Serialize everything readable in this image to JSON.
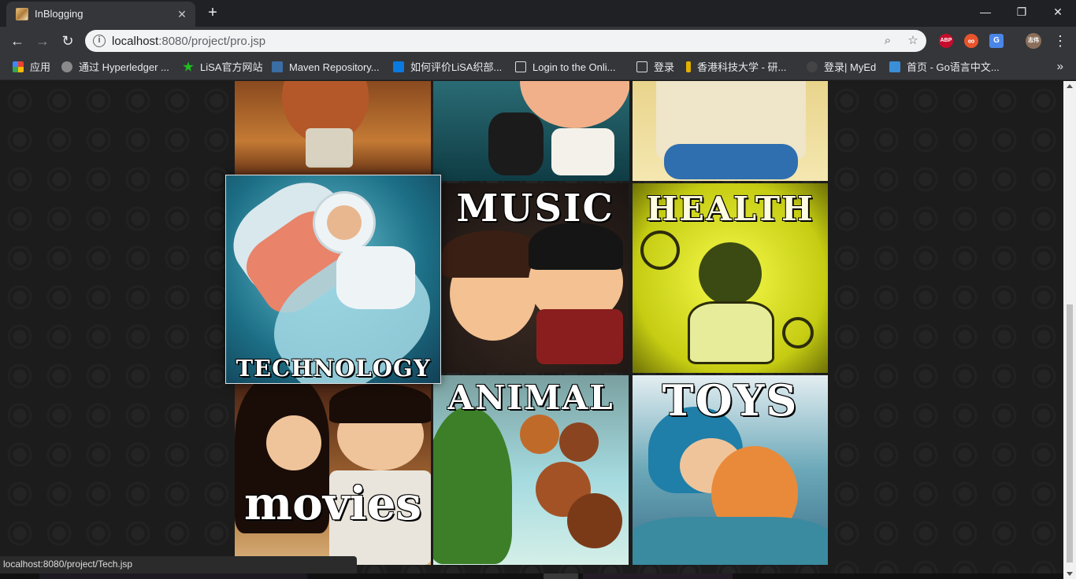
{
  "window": {
    "tab_title": "InBlogging",
    "tab_close": "✕",
    "new_tab": "+",
    "minimize": "—",
    "restore": "❐",
    "close": "✕"
  },
  "toolbar": {
    "back": "←",
    "forward": "→",
    "reload": "↻",
    "url_host": "localhost",
    "url_path": ":8080/project/pro.jsp",
    "zoom_icon": "⌕",
    "star_icon": "☆",
    "extensions": [
      {
        "name": "abp-icon",
        "label": "ABP",
        "color": "#c70d2c"
      },
      {
        "name": "infinity-icon",
        "label": "∞",
        "color": "#e8542c"
      },
      {
        "name": "translate-icon",
        "label": "G",
        "color": "#4a86e8"
      }
    ],
    "avatar_label": "志伟",
    "menu": "⋮"
  },
  "bookmarks": {
    "items": [
      {
        "label": "应用",
        "color": "#e94235"
      },
      {
        "label": "通过 Hyperledger ...",
        "color": "#cfcfcf"
      },
      {
        "label": "LiSA官方网站",
        "color": "#1fbf1f"
      },
      {
        "label": "Maven Repository...",
        "color": "#3a6ea5"
      },
      {
        "label": "如何评价LiSA织部...",
        "color": "#0a7ae0"
      },
      {
        "label": "Login to the Onli...",
        "color": "#dcdcdc"
      },
      {
        "label": "登录",
        "color": "#dcdcdc"
      },
      {
        "label": "香港科技大学 - 研...",
        "color": "#e2b100"
      },
      {
        "label": "登录| MyEd",
        "color": "#444444"
      },
      {
        "label": "首页 - Go语言中文...",
        "color": "#3b8fd6"
      }
    ],
    "more": "»"
  },
  "gallery": {
    "tiles": [
      {
        "key": "top-left",
        "label": ""
      },
      {
        "key": "top-middle",
        "label": ""
      },
      {
        "key": "top-right",
        "label": ""
      },
      {
        "key": "technology",
        "label": "TECHNOLOGY"
      },
      {
        "key": "music",
        "label": "MUSIC"
      },
      {
        "key": "health",
        "label": "HEALTH"
      },
      {
        "key": "movies",
        "label": "movies"
      },
      {
        "key": "animal",
        "label": "ANIMAL"
      },
      {
        "key": "toys",
        "label": "TOYS"
      }
    ]
  },
  "status_bar": {
    "text": "localhost:8080/project/Tech.jsp"
  }
}
